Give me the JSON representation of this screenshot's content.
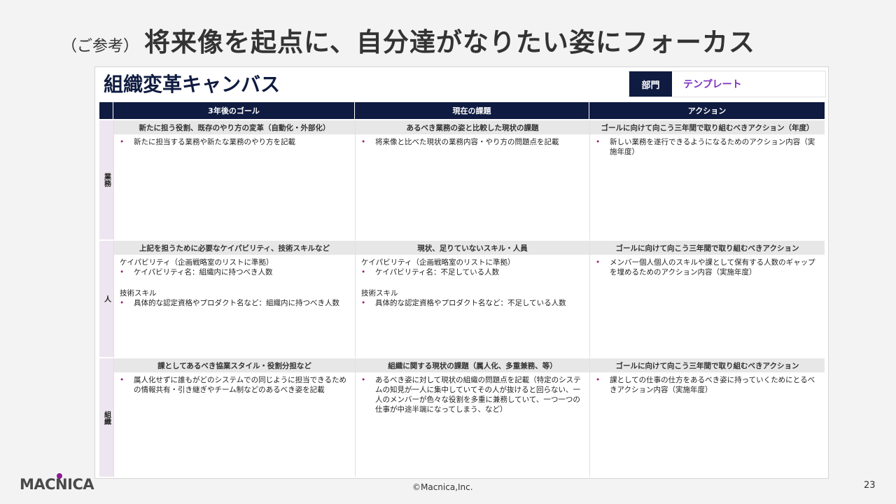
{
  "slide": {
    "title_prefix": "（ご参考）",
    "title_main": "将来像を起点に、自分達がなりたい姿にフォーカス",
    "logo": "MACNICA",
    "copyright": "©Macnica,Inc.",
    "page_number": "23"
  },
  "canvas": {
    "title": "組織変革キャンバス",
    "dept_label": "部門",
    "dept_value": "テンプレート",
    "columns": [
      "3年後のゴール",
      "現在の課題",
      "アクション"
    ],
    "rows": [
      {
        "label": "業務",
        "cells": [
          {
            "subheader": "新たに担う役割、既存のやり方の変革（自動化・外部化）",
            "lines": [
              {
                "type": "bullet",
                "text": "新たに担当する業務や新たな業務のやり方を記載"
              }
            ]
          },
          {
            "subheader": "あるべき業務の姿と比較した現状の課題",
            "lines": [
              {
                "type": "bullet",
                "text": "将来像と比べた現状の業務内容・やり方の問題点を記載"
              }
            ]
          },
          {
            "subheader": "ゴールに向けて向こう三年間で取り組むべきアクション（年度）",
            "lines": [
              {
                "type": "bullet",
                "text": "新しい業務を遂行できるようになるためのアクション内容（実施年度）"
              }
            ]
          }
        ]
      },
      {
        "label": "人",
        "cells": [
          {
            "subheader": "上記を担うために必要なケイパビリティ、技術スキルなど",
            "lines": [
              {
                "type": "plain",
                "text": "ケイパビリティ（企画戦略室のリストに準拠）"
              },
              {
                "type": "bullet",
                "text": "ケイパビリティ名：組織内に持つべき人数"
              },
              {
                "type": "gap",
                "text": ""
              },
              {
                "type": "plain",
                "text": "技術スキル"
              },
              {
                "type": "bullet",
                "text": "具体的な認定資格やプロダクト名など：組織内に持つべき人数"
              }
            ]
          },
          {
            "subheader": "現状、足りていないスキル・人員",
            "lines": [
              {
                "type": "plain",
                "text": "ケイパビリティ（企画戦略室のリストに準拠）"
              },
              {
                "type": "bullet",
                "text": "ケイパビリティ名：不足している人数"
              },
              {
                "type": "gap",
                "text": ""
              },
              {
                "type": "plain",
                "text": "技術スキル"
              },
              {
                "type": "bullet",
                "text": "具体的な認定資格やプロダクト名など：不足している人数"
              }
            ]
          },
          {
            "subheader": "ゴールに向けて向こう三年間で取り組むべきアクション",
            "lines": [
              {
                "type": "bullet",
                "text": "メンバー個人個人のスキルや課として保有する人数のギャップを埋めるためのアクション内容（実施年度）"
              }
            ]
          }
        ]
      },
      {
        "label": "組織",
        "cells": [
          {
            "subheader": "課としてあるべき協業スタイル・役割分担など",
            "lines": [
              {
                "type": "bullet",
                "text": "属人化せずに誰もがどのシステムでの同じように担当できるための情報共有・引き継ぎやチーム制などのあるべき姿を記載"
              }
            ]
          },
          {
            "subheader": "組織に関する現状の課題（属人化、多重兼務、等）",
            "lines": [
              {
                "type": "bullet",
                "text": "あるべき姿に対して現状の組織の問題点を記載（特定のシステムの知見が一人に集中していてその人が抜けると回らない、一人のメンバーが色々な役割を多重に兼務していて、一つ一つの仕事が中途半端になってしまう、など）"
              }
            ]
          },
          {
            "subheader": "ゴールに向けて向こう三年間で取り組むべきアクション",
            "lines": [
              {
                "type": "bullet",
                "text": "課としての仕事の仕方をあるべき姿に持っていくためにとるべきアクション内容（実施年度）"
              }
            ]
          }
        ]
      }
    ]
  }
}
